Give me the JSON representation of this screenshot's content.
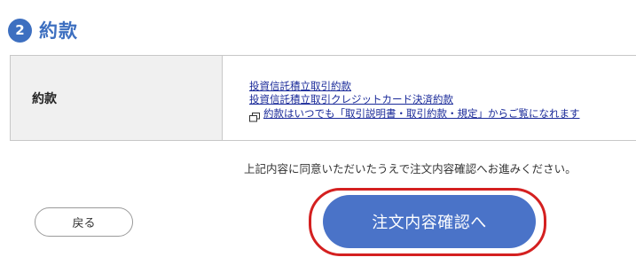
{
  "section": {
    "step_number": "2",
    "title": "約款"
  },
  "terms_table": {
    "label": "約款",
    "links": [
      "投資信託積立取引約款",
      "投資信託積立取引クレジットカード決済約款"
    ],
    "note": "約款はいつでも「取引説明書・取引約款・規定」からご覧になれます"
  },
  "agreement_text": "上記内容に同意いただいたうえで注文内容確認へお進みください。",
  "buttons": {
    "back_label": "戻る",
    "confirm_label": "注文内容確認へ"
  },
  "colors": {
    "accent": "#3d6fc0",
    "primary_button": "#4a73c8",
    "highlight": "#d42020",
    "link": "#1a2a99"
  }
}
